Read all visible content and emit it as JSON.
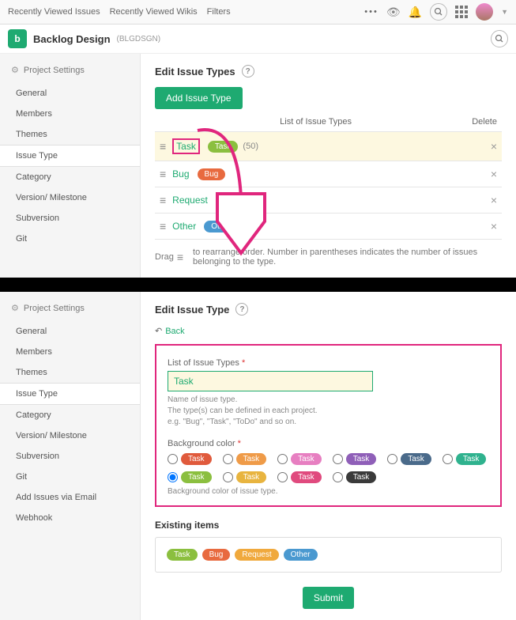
{
  "topnav": {
    "items": [
      "Recently Viewed Issues",
      "Recently Viewed Wikis",
      "Filters"
    ]
  },
  "project": {
    "icon_letter": "b",
    "name": "Backlog Design",
    "code": "(BLGDSGN)"
  },
  "sidebar_top": {
    "header": "Project Settings",
    "items": [
      "General",
      "Members",
      "Themes",
      "Issue Type",
      "Category",
      "Version/ Milestone",
      "Subversion",
      "Git"
    ],
    "active": "Issue Type"
  },
  "sidebar_bottom": {
    "header": "Project Settings",
    "items": [
      "General",
      "Members",
      "Themes",
      "Issue Type",
      "Category",
      "Version/ Milestone",
      "Subversion",
      "Git",
      "Add Issues via Email",
      "Webhook"
    ],
    "active": "Issue Type"
  },
  "page_top": {
    "title": "Edit Issue Types",
    "add_button": "Add Issue Type",
    "list_header": "List of Issue Types",
    "delete_header": "Delete",
    "rows": [
      {
        "name": "Task",
        "pill_label": "Task",
        "pill_color": "#8bbf3f",
        "count": "(50)",
        "highlight": true
      },
      {
        "name": "Bug",
        "pill_label": "Bug",
        "pill_color": "#e86a3f"
      },
      {
        "name": "Request",
        "pill_label": "Request",
        "pill_color": "#f0a93d"
      },
      {
        "name": "Other",
        "pill_label": "Other",
        "pill_color": "#4a99d0"
      }
    ],
    "hint_prefix": "Drag",
    "hint_suffix": "to rearrange order. Number in parentheses indicates the number of issues belonging to the type."
  },
  "page_bottom": {
    "title": "Edit Issue Type",
    "back": "Back",
    "name_label": "List of Issue Types",
    "name_value": "Task",
    "name_help": "Name of issue type.\nThe type(s) can be defined in each project.\ne.g. \"Bug\", \"Task\", \"ToDo\" and so on.",
    "bg_label": "Background color",
    "bg_help": "Background color of issue type.",
    "colors": [
      {
        "label": "Task",
        "hex": "#e05a3c"
      },
      {
        "label": "Task",
        "hex": "#ef9b48"
      },
      {
        "label": "Task",
        "hex": "#e77fc1"
      },
      {
        "label": "Task",
        "hex": "#8f5fb8"
      },
      {
        "label": "Task",
        "hex": "#4a6a8a"
      },
      {
        "label": "Task",
        "hex": "#2fb28e"
      },
      {
        "label": "Task",
        "hex": "#8bbf3f",
        "selected": true
      },
      {
        "label": "Task",
        "hex": "#e8b43f"
      },
      {
        "label": "Task",
        "hex": "#e04a7e"
      },
      {
        "label": "Task",
        "hex": "#3a3a3a"
      }
    ],
    "existing_title": "Existing items",
    "existing": [
      {
        "label": "Task",
        "hex": "#8bbf3f"
      },
      {
        "label": "Bug",
        "hex": "#e86a3f"
      },
      {
        "label": "Request",
        "hex": "#f0a93d"
      },
      {
        "label": "Other",
        "hex": "#4a99d0"
      }
    ],
    "submit": "Submit"
  }
}
